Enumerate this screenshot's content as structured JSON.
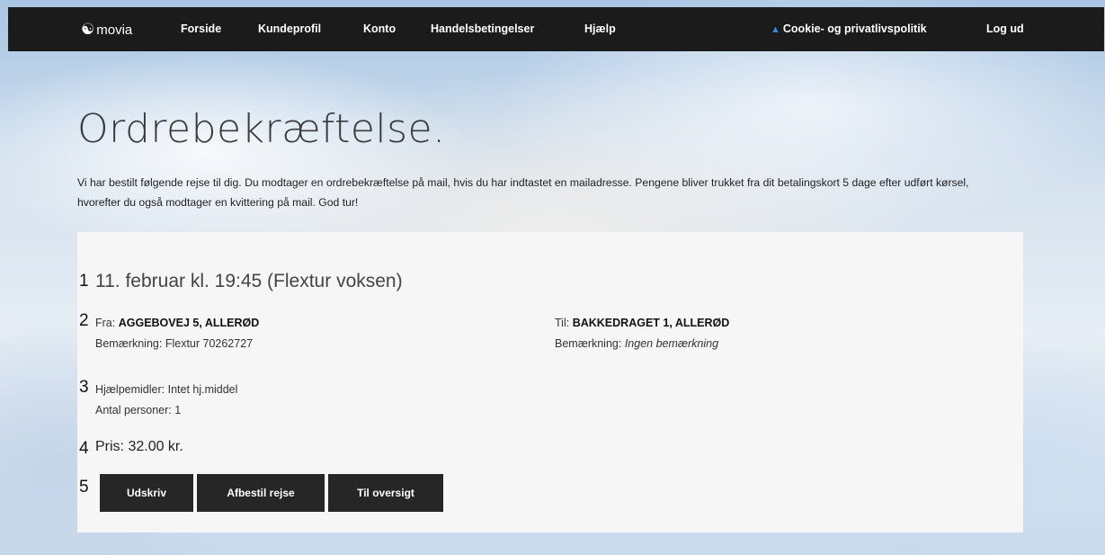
{
  "nav": {
    "logo": "movia",
    "items": [
      "Forside",
      "Kundeprofil",
      "Konto",
      "Handelsbetingelser",
      "Hjælp"
    ],
    "cookie": "Cookie- og privatlivspolitik",
    "logout": "Log ud"
  },
  "page": {
    "title": "Ordrebekræftelse.",
    "intro": "Vi har bestilt følgende rejse til dig. Du modtager en ordrebekræftelse på mail, hvis du har indtastet en mailadresse. Pengene bliver trukket fra dit betalingskort 5 dage efter udført kørsel, hvorefter du også modtager en kvittering på mail. God tur!"
  },
  "numbers": [
    "1",
    "2",
    "3",
    "4",
    "5"
  ],
  "trip": {
    "date": "11. februar kl. 19:45 (Flextur voksen)",
    "from_label": "Fra:",
    "from": "AGGEBOVEJ 5, ALLERØD",
    "from_note_label": "Bemærkning:",
    "from_note": "Flextur 70262727",
    "to_label": "Til:",
    "to": "BAKKEDRAGET 1, ALLERØD",
    "to_note_label": "Bemærkning:",
    "to_note": "Ingen bemærkning",
    "aids_label": "Hjælpemidler:",
    "aids": "Intet hj.middel",
    "persons_label": "Antal personer:",
    "persons": "1",
    "price": "Pris: 32.00 kr."
  },
  "buttons": {
    "print": "Udskriv",
    "cancel": "Afbestil rejse",
    "overview": "Til oversigt"
  },
  "colors": {
    "topbar": "#1b1b1b",
    "button": "#262626",
    "warning_icon": "#2e8bd8"
  },
  "icons": {
    "logo": "movia-logo-icon",
    "warning": "warning-triangle-icon"
  }
}
